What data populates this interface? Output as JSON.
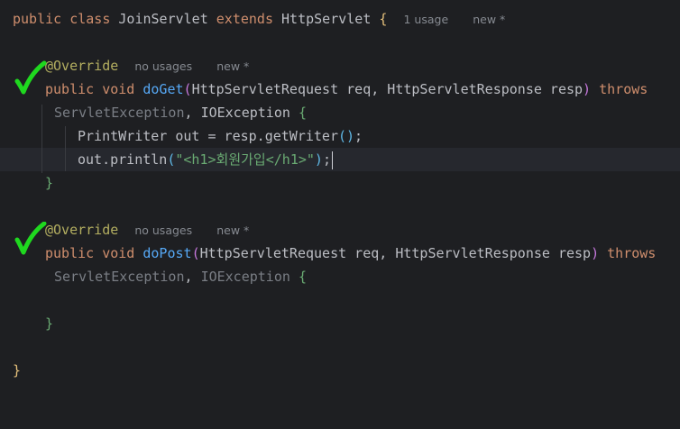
{
  "code": {
    "l1": {
      "kw1": "public",
      "kw2": "class",
      "name": "JoinServlet",
      "kw3": "extends",
      "parent": "HttpServlet",
      "brace": "{",
      "hint_usage": "1 usage",
      "hint_new": "new *"
    },
    "l2": {
      "annotation": "@Override",
      "hint_usage": "no usages",
      "hint_new": "new *"
    },
    "l3": {
      "kw1": "public",
      "kw2": "void",
      "method": "doGet",
      "paren_open": "(",
      "params": "HttpServletRequest req, HttpServletResponse resp",
      "paren_close": ")",
      "throws": "throws"
    },
    "l4": {
      "exc1": "ServletException",
      "sep": ", ",
      "exc2": "IOException",
      "brace": "{"
    },
    "l5": {
      "text": "PrintWriter out = resp.getWriter",
      "parens": "()",
      "semi": ";"
    },
    "l6": {
      "prefix": "out.println",
      "paren_open": "(",
      "string": "\"<h1>회원가입</h1>\"",
      "paren_close": ")",
      "semi": ";"
    },
    "l7": {
      "brace": "}"
    },
    "l8": {
      "annotation": "@Override",
      "hint_usage": "no usages",
      "hint_new": "new *"
    },
    "l9": {
      "kw1": "public",
      "kw2": "void",
      "method": "doPost",
      "paren_open": "(",
      "params": "HttpServletRequest req, HttpServletResponse resp",
      "paren_close": ")",
      "throws": "throws"
    },
    "l10": {
      "exc1": "ServletException",
      "sep": ", ",
      "exc2": "IOException",
      "brace": "{"
    },
    "l11": {
      "brace": "}"
    },
    "l12": {
      "brace": "}"
    }
  },
  "annotations": {
    "checkmark_color": "#1fd81f",
    "checkmark_icon": "green-checkmark-icon"
  },
  "theme": {
    "background": "#1e1f22",
    "current_line": "#26282e",
    "keyword": "#cf8e6d",
    "function": "#56a8f5",
    "annotation": "#b3ae60",
    "string": "#6aab73"
  }
}
